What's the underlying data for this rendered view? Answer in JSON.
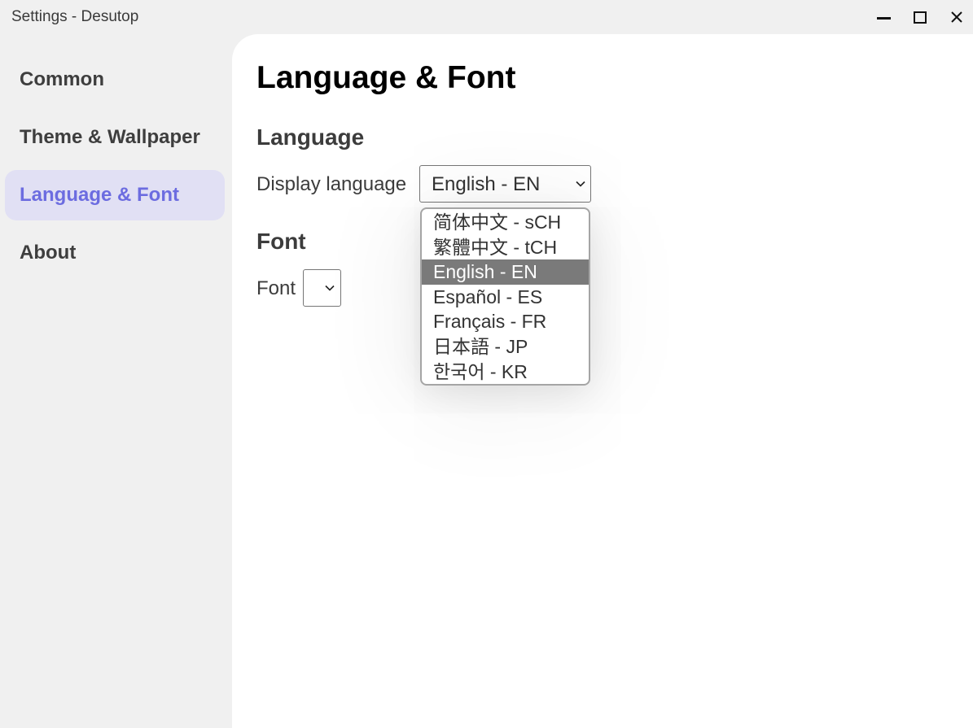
{
  "window": {
    "title": "Settings - Desutop",
    "controls": [
      "minimize-icon",
      "maximize-icon",
      "close-icon"
    ]
  },
  "sidebar": {
    "items": [
      {
        "label": "Common",
        "active": false
      },
      {
        "label": "Theme & Wallpaper",
        "active": false
      },
      {
        "label": "Language & Font",
        "active": true
      },
      {
        "label": "About",
        "active": false
      }
    ]
  },
  "main": {
    "title": "Language & Font",
    "language_section": {
      "heading": "Language",
      "display_language_label": "Display language",
      "selected": "English - EN",
      "options": [
        "简体中文 - sCH",
        "繁體中文 - tCH",
        "English - EN",
        "Español - ES",
        "Français - FR",
        "日本語 - JP",
        "한국어 - KR"
      ],
      "highlighted_index": 2
    },
    "font_section": {
      "heading": "Font",
      "font_label": "Font",
      "selected": ""
    }
  },
  "colors": {
    "accent": "#6c6ce0",
    "active_nav_bg": "#e1e0f4",
    "sidebar_bg": "#f0f0f0",
    "content_bg": "#ffffff",
    "option_highlight": "#7a7a7a"
  }
}
